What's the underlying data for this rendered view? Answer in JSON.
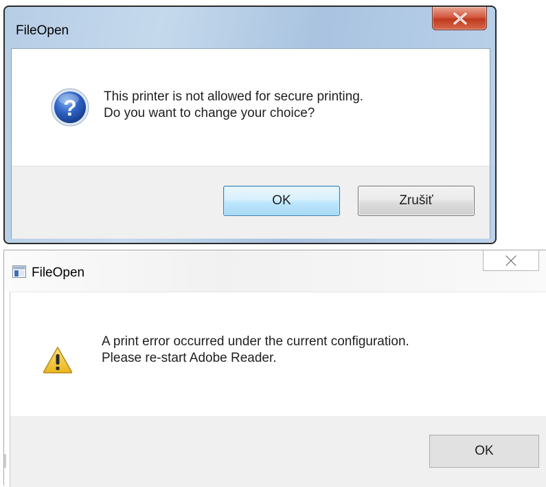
{
  "dialogs": [
    {
      "title": "FileOpen",
      "message_line1": "This printer is not allowed for secure printing.",
      "message_line2": "Do you want to change your choice?",
      "icon": "question-icon",
      "buttons": {
        "ok": "OK",
        "cancel": "Zrušiť"
      },
      "close_icon": "close-icon"
    },
    {
      "title": "FileOpen",
      "message_line1": "A print error occurred under the current configuration.",
      "message_line2": "Please re-start Adobe Reader.",
      "icon": "warning-icon",
      "app_icon": "window-app-icon",
      "buttons": {
        "ok": "OK"
      },
      "close_icon": "close-icon"
    }
  ],
  "colors": {
    "aero_frame": "#b6cde6",
    "close_button_red": "#c7442a",
    "default_button_blue": "#bee6fd",
    "footer_gray": "#f0f0f0",
    "warning_yellow": "#f3c623"
  }
}
